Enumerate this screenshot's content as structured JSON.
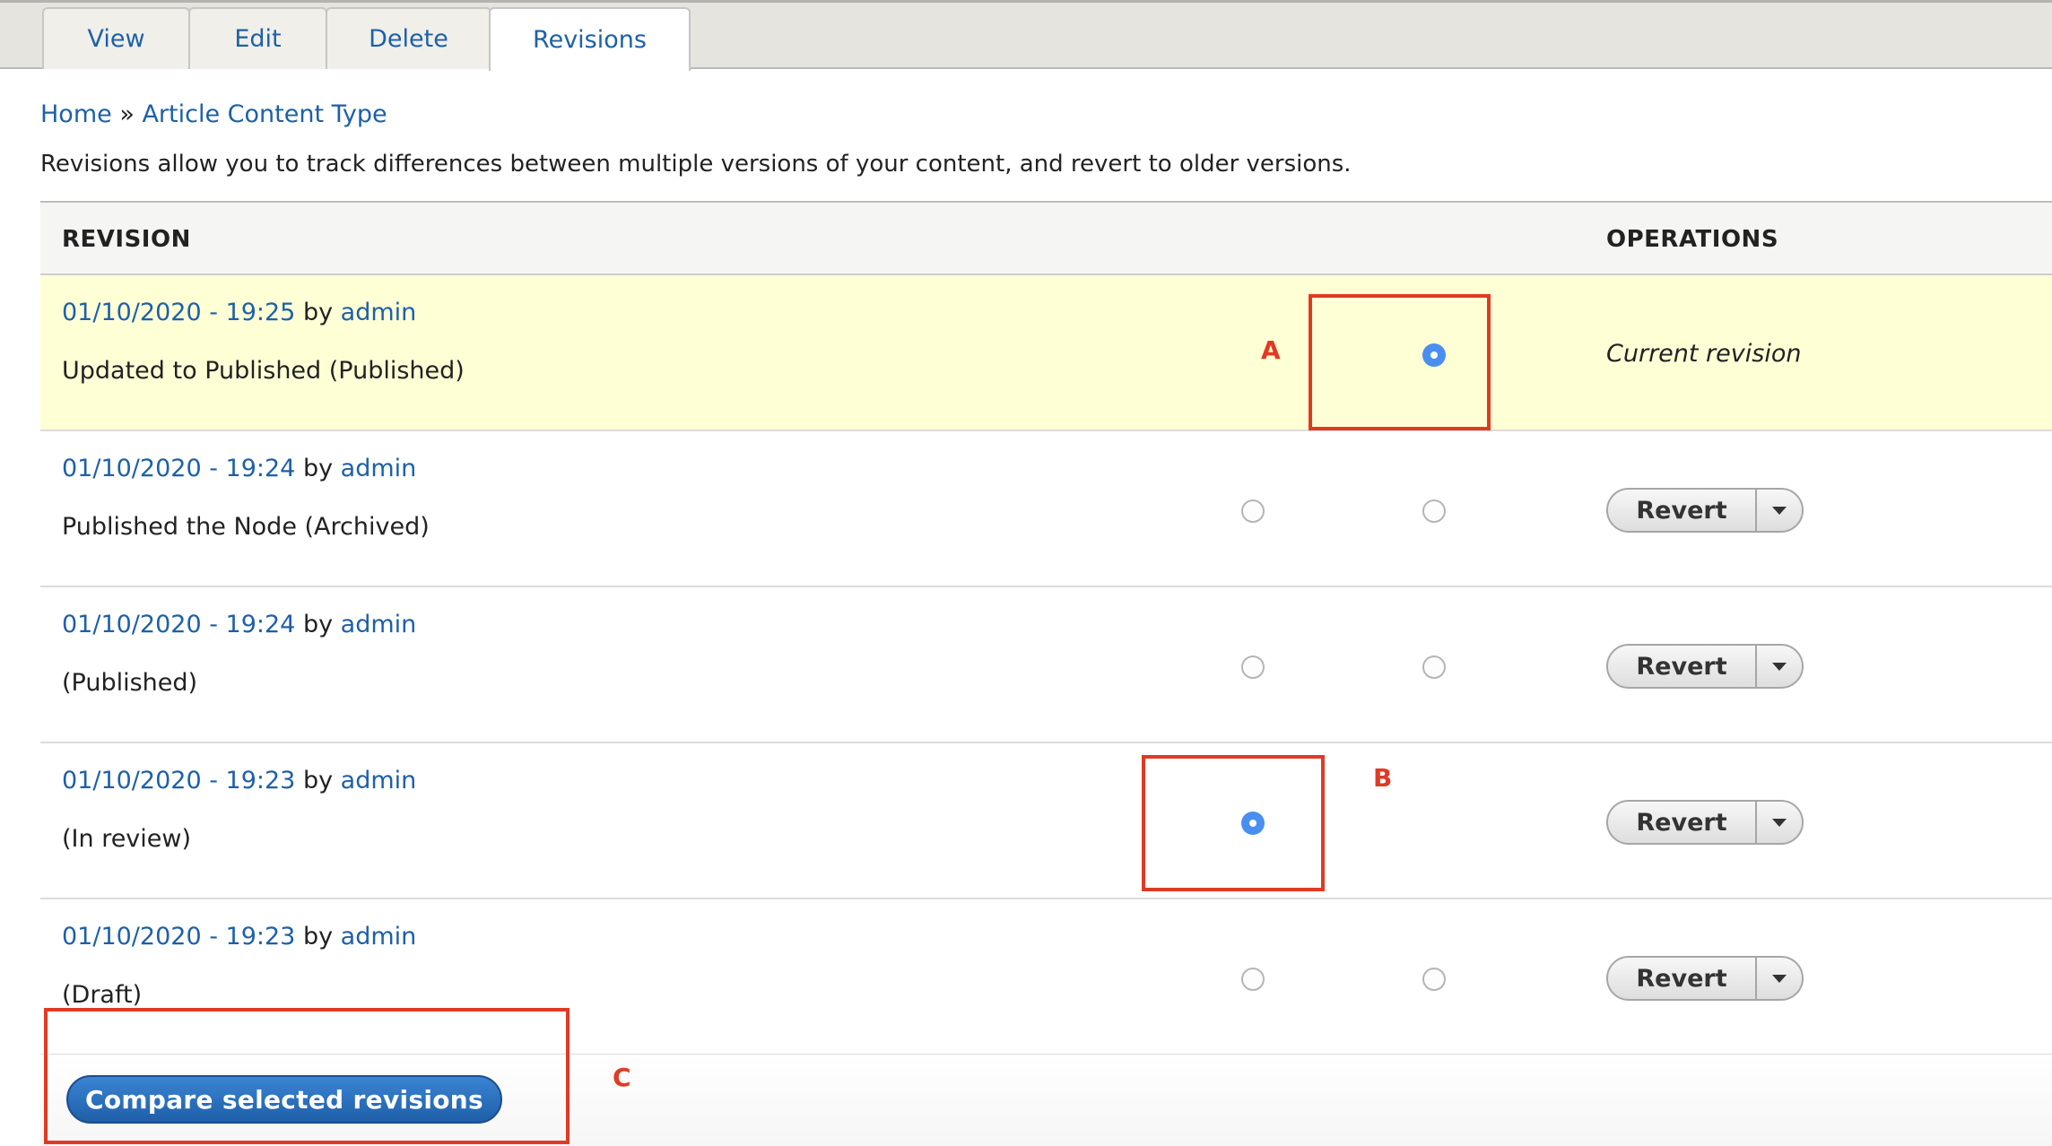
{
  "tabs": [
    {
      "label": "View"
    },
    {
      "label": "Edit"
    },
    {
      "label": "Delete"
    },
    {
      "label": "Revisions",
      "active": true
    }
  ],
  "breadcrumb": {
    "home": "Home",
    "separator": "»",
    "current": "Article Content Type"
  },
  "description": "Revisions allow you to track differences between multiple versions of your content, and revert to older versions.",
  "table": {
    "headers": {
      "revision": "REVISION",
      "operations": "OPERATIONS"
    },
    "rows": [
      {
        "date": "01/10/2020 - 19:25",
        "by": "by",
        "author": "admin",
        "message": "Updated to Published (Published)",
        "current": true,
        "radio_left": null,
        "radio_right": true,
        "operation": "Current revision"
      },
      {
        "date": "01/10/2020 - 19:24",
        "by": "by",
        "author": "admin",
        "message": "Published the Node (Archived)",
        "current": false,
        "radio_left": false,
        "radio_right": false,
        "operation": "Revert"
      },
      {
        "date": "01/10/2020 - 19:24",
        "by": "by",
        "author": "admin",
        "message": "(Published)",
        "current": false,
        "radio_left": false,
        "radio_right": false,
        "operation": "Revert"
      },
      {
        "date": "01/10/2020 - 19:23",
        "by": "by",
        "author": "admin",
        "message": "(In review)",
        "current": false,
        "radio_left": true,
        "radio_right": null,
        "operation": "Revert"
      },
      {
        "date": "01/10/2020 - 19:23",
        "by": "by",
        "author": "admin",
        "message": "(Draft)",
        "current": false,
        "radio_left": false,
        "radio_right": false,
        "operation": "Revert"
      }
    ]
  },
  "compare_button": "Compare selected revisions",
  "annotations": {
    "a": "A",
    "b": "B",
    "c": "C"
  },
  "colors": {
    "link": "#1d60a8",
    "current_row": "#ffffd6",
    "annotation": "#e03a25",
    "primary_button": "#2a6fbf",
    "radio_checked": "#4a8ef0"
  },
  "icons": {
    "revert_toggle": "caret-down-icon"
  }
}
